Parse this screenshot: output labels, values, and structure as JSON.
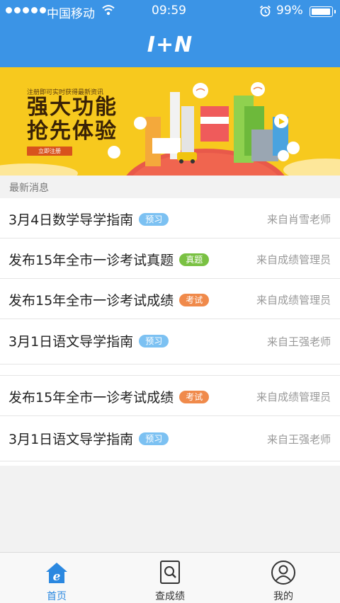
{
  "status_bar": {
    "carrier": "中国移动",
    "time": "09:59",
    "battery": "99%"
  },
  "header": {
    "logo": "I+N"
  },
  "banner": {
    "subtitle": "注册即可实时获得最新资讯",
    "title_line1": "强大功能",
    "title_line2": "抢先体验",
    "button": "立即注册"
  },
  "section_title": "最新消息",
  "news": [
    {
      "title": "3月4日数学导学指南",
      "tag": "预习",
      "tag_color": "#7cc1f2",
      "source": "来自肖雪老师"
    },
    {
      "title": "发布15年全市一诊考试真题",
      "tag": "真题",
      "tag_color": "#7ac143",
      "source": "来自成绩管理员"
    },
    {
      "title": "发布15年全市一诊考试成绩",
      "tag": "考试",
      "tag_color": "#f08a4b",
      "source": "来自成绩管理员"
    },
    {
      "title": "3月1日语文导学指南",
      "tag": "预习",
      "tag_color": "#7cc1f2",
      "source": "来自王强老师"
    },
    {
      "title": "发布15年全市一诊考试成绩",
      "tag": "考试",
      "tag_color": "#f08a4b",
      "source": "来自成绩管理员"
    },
    {
      "title": "3月1日语文导学指南",
      "tag": "预习",
      "tag_color": "#7cc1f2",
      "source": "来自王强老师"
    }
  ],
  "tabs": [
    {
      "label": "首页",
      "icon": "home-icon",
      "active": true
    },
    {
      "label": "查成绩",
      "icon": "search-document-icon",
      "active": false
    },
    {
      "label": "我的",
      "icon": "user-icon",
      "active": false
    }
  ],
  "colors": {
    "header": "#3b94e6",
    "banner": "#f7c91e",
    "active_tab": "#2b88e0"
  }
}
